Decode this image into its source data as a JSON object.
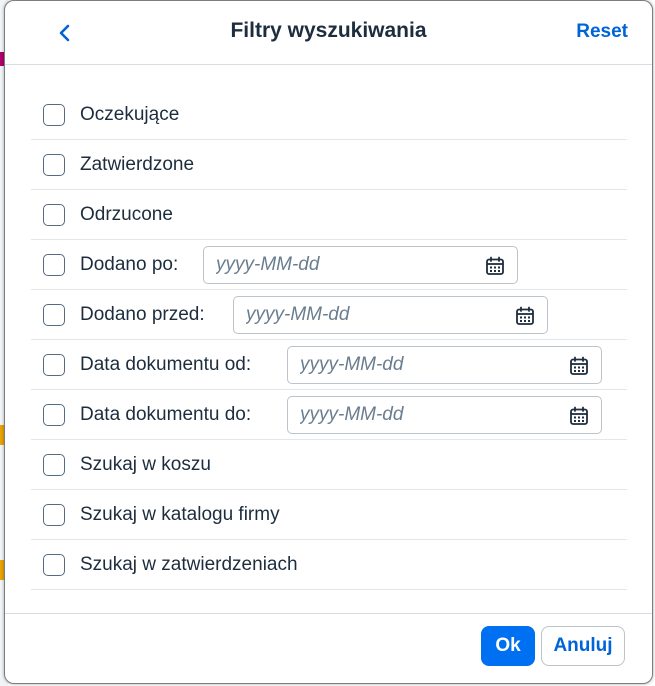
{
  "dialog": {
    "title": "Filtry wyszukiwania",
    "back_icon": "chevron-left-icon",
    "reset_label": "Reset"
  },
  "filters": {
    "pending": "Oczekujące",
    "approved": "Zatwierdzone",
    "rejected": "Odrzucone",
    "added_after": "Dodano po:",
    "added_before": "Dodano przed:",
    "doc_date_from": "Data dokumentu od:",
    "doc_date_to": "Data dokumentu do:",
    "search_trash": "Szukaj w koszu",
    "search_company_catalog": "Szukaj w katalogu firmy",
    "search_approvals": "Szukaj w zatwierdzeniach"
  },
  "date_placeholder": "yyyy-MM-dd",
  "calendar_icon": "calendar-icon",
  "footer": {
    "ok_label": "Ok",
    "cancel_label": "Anuluj"
  },
  "colors": {
    "accent": "#0070f2",
    "link": "#0064d9",
    "text": "#1d2d3e"
  }
}
